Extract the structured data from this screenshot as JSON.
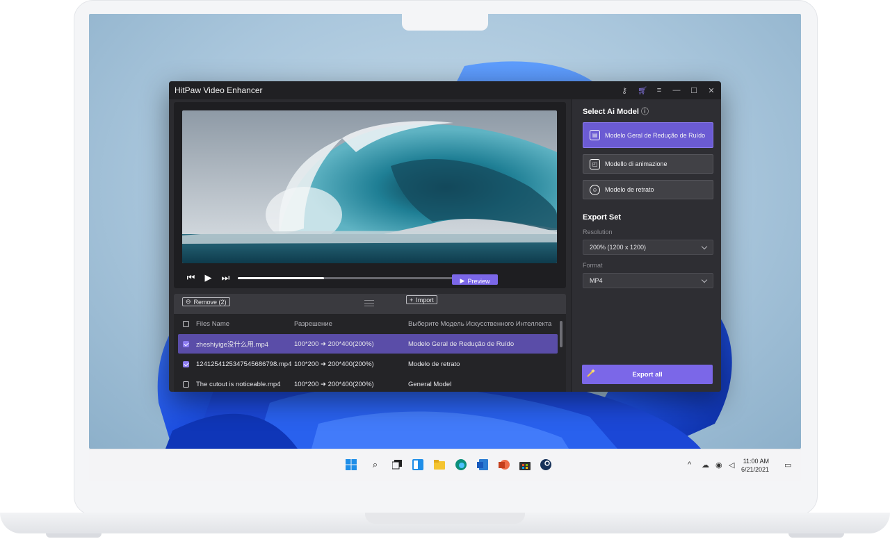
{
  "app": {
    "title": "HitPaw Video Enhancer",
    "window_icons": [
      "key-icon",
      "cart-icon",
      "menu-icon",
      "minimize-icon",
      "maximize-icon",
      "close-icon"
    ]
  },
  "player": {
    "progress": 0.4,
    "preview_label": "Preview"
  },
  "toolbar": {
    "remove_label": "Remove (2)",
    "import_label": "Import"
  },
  "file_list": {
    "headers": {
      "name": "Files Name",
      "resolution": "Разрешение",
      "model": "Выберите Модель Искусственного Интеллекта"
    },
    "rows": [
      {
        "name": "zheshiyige没什么用.mp4",
        "from": "100*200",
        "to": "200*400(200%)",
        "model": "Modelo Geral de Redução de Ruído",
        "checked": true,
        "selected": true
      },
      {
        "name": "12412541253475456867​98.mp4",
        "from": "100*200",
        "to": "200*400(200%)",
        "model": "Modelo de retrato",
        "checked": true,
        "selected": false
      },
      {
        "name": "The cutout is noticeable.mp4",
        "from": "100*200",
        "to": "200*400(200%)",
        "model": "General Model",
        "checked": false,
        "selected": false
      }
    ]
  },
  "panel": {
    "model_title": "Select Ai Model",
    "models": [
      {
        "label": "Modelo Geral de Redução de Ruído",
        "icon": "film-icon",
        "active": true
      },
      {
        "label": "Modello di animazione",
        "icon": "animation-icon",
        "active": false
      },
      {
        "label": "Modelo de retrato",
        "icon": "face-icon",
        "active": false
      }
    ],
    "export_title": "Export Set",
    "resolution_label": "Resolution",
    "resolution_value": "200% (1200 x 1200)",
    "format_label": "Format",
    "format_value": "MP4",
    "export_label": "Export all"
  },
  "taskbar": {
    "time": "11:00 AM",
    "date": "6/21/2021"
  }
}
